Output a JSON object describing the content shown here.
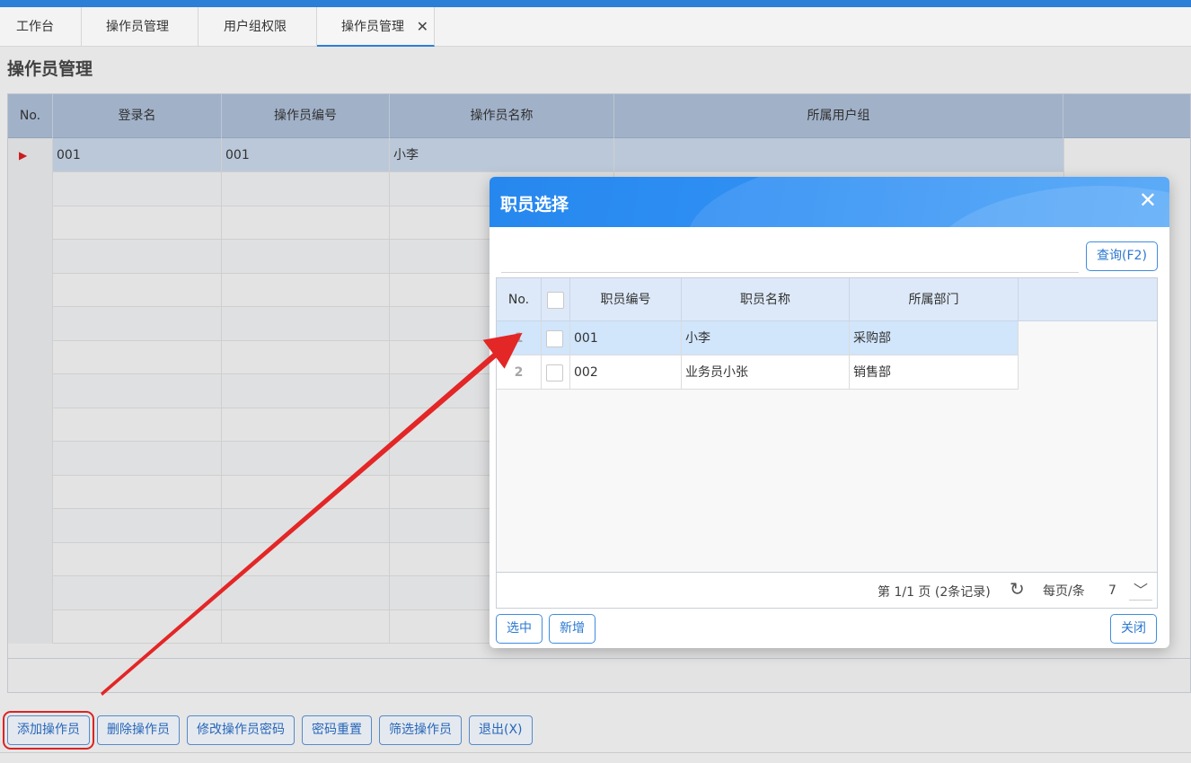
{
  "tabs": [
    {
      "label": "工作台"
    },
    {
      "label": "操作员管理"
    },
    {
      "label": "用户组权限"
    },
    {
      "label": "操作员管理",
      "closable": true
    }
  ],
  "page_title": "操作员管理",
  "main_table": {
    "columns": [
      "No.",
      "登录名",
      "操作员编号",
      "操作员名称",
      "所属用户组"
    ],
    "rows": [
      {
        "login": "001",
        "code": "001",
        "name": "小李",
        "group": ""
      }
    ]
  },
  "toolbar": {
    "add": "添加操作员",
    "delete": "删除操作员",
    "change_pwd": "修改操作员密码",
    "reset_pwd": "密码重置",
    "filter": "筛选操作员",
    "exit": "退出(X)"
  },
  "dialog": {
    "title": "职员选择",
    "close_glyph": "✕",
    "query_button": "查询(F2)",
    "columns": [
      "No.",
      "职员编号",
      "职员名称",
      "所属部门"
    ],
    "rows": [
      {
        "no": "1",
        "code": "001",
        "name": "小李",
        "dept": "采购部"
      },
      {
        "no": "2",
        "code": "002",
        "name": "业务员小张",
        "dept": "销售部"
      }
    ],
    "pager": {
      "info": "第 1/1 页 (2条记录)",
      "per_page_label": "每页/条",
      "per_page_value": "7"
    },
    "buttons": {
      "select": "选中",
      "new": "新增",
      "close": "关闭"
    }
  },
  "colors": {
    "accent": "#2b7fd6",
    "highlight_red": "#e32626"
  },
  "icons": {
    "tab_close": "close-icon",
    "row_marker": "row-indicator-icon",
    "refresh": "refresh-icon",
    "dropdown": "chevron-down-icon"
  }
}
